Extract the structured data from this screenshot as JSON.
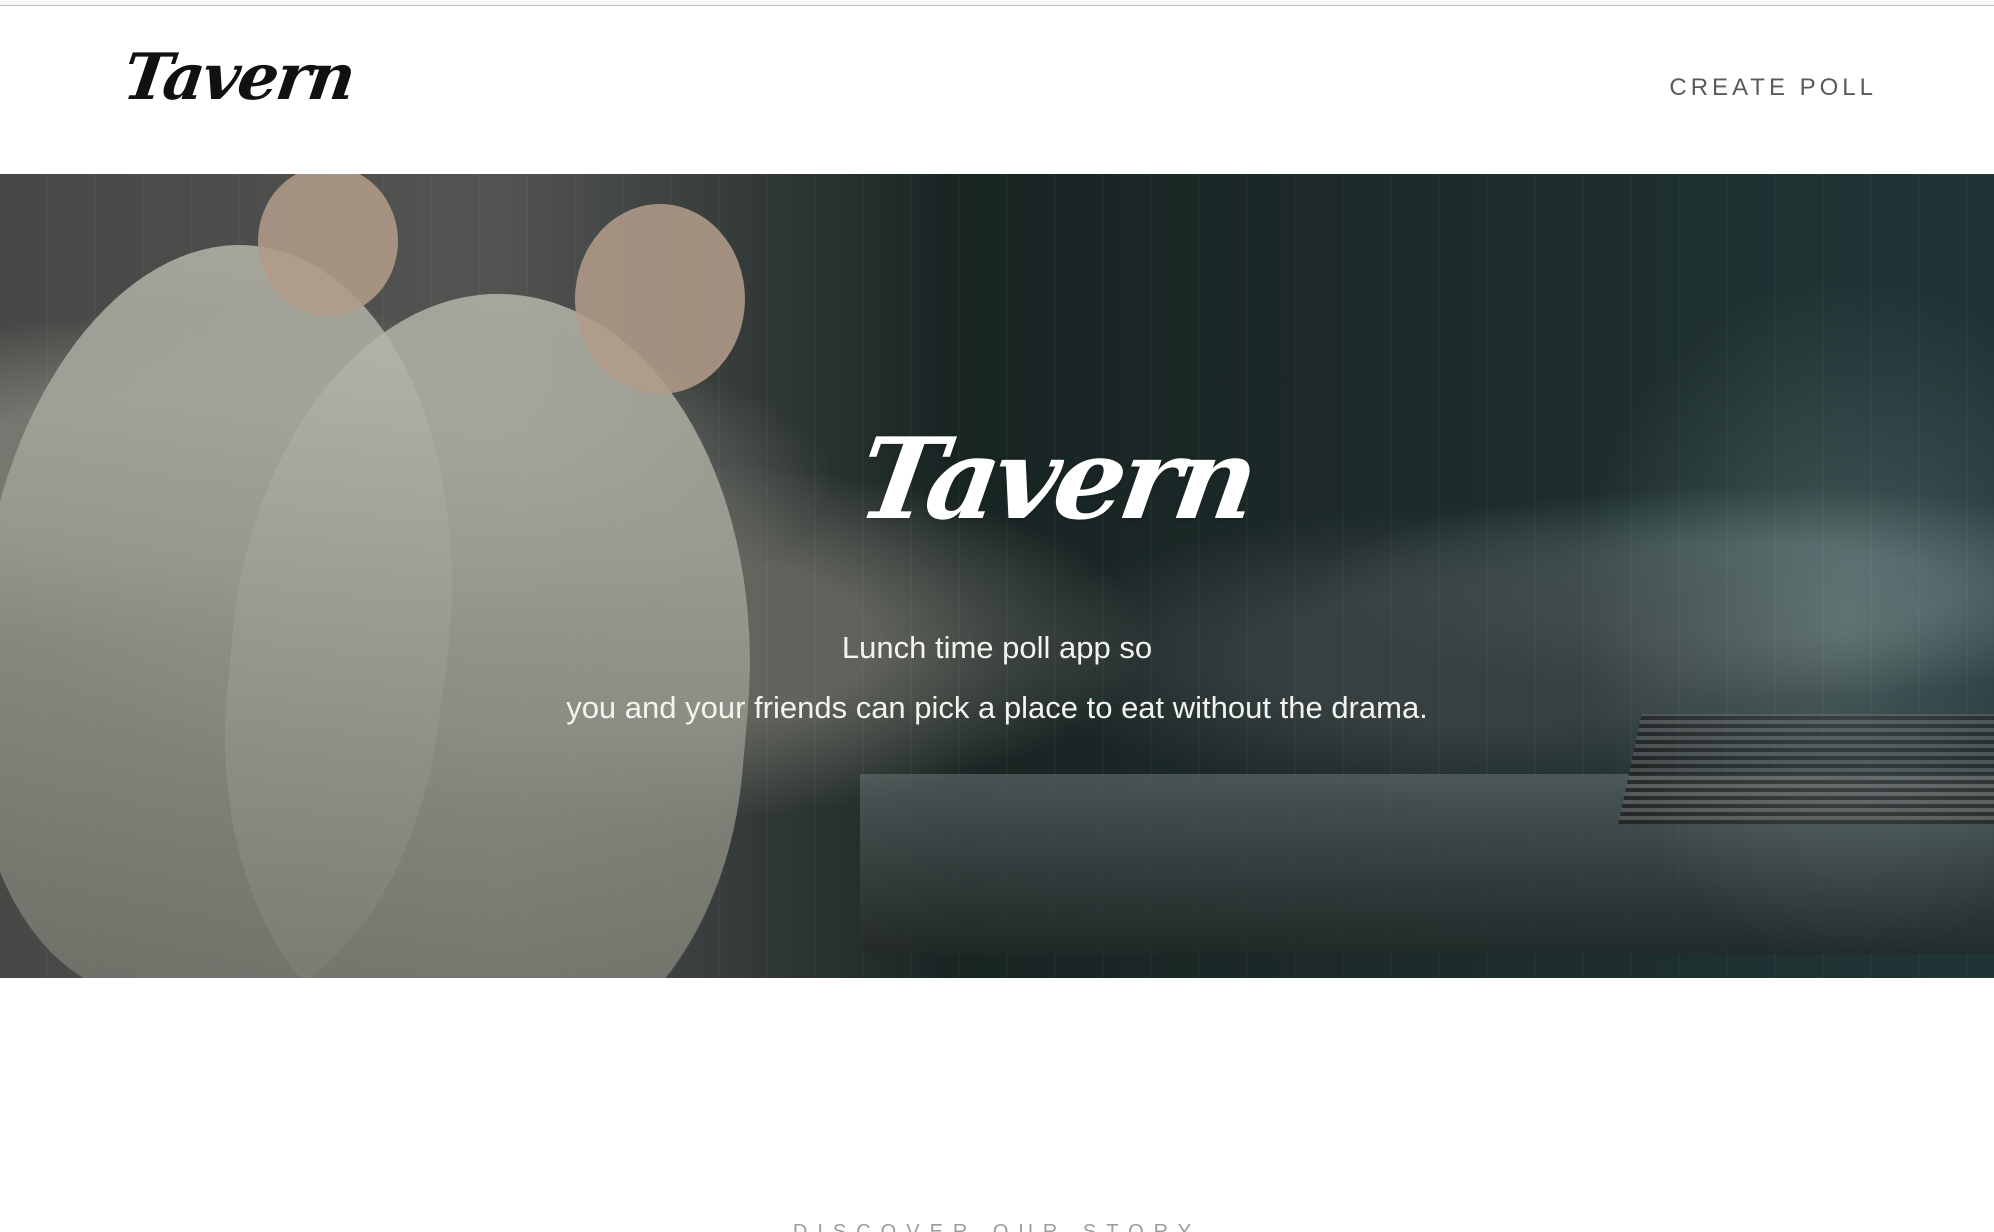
{
  "brand": {
    "name": "Tavern"
  },
  "nav": {
    "create_poll": "CREATE POLL"
  },
  "hero": {
    "title": "Tavern",
    "tagline_line_1": "Lunch time poll app so",
    "tagline_line_2": "you and your friends can pick a place to eat without the drama."
  },
  "section": {
    "discover_label": "DISCOVER OUR STORY"
  },
  "colors": {
    "background": "#ffffff",
    "logo": "#111111",
    "nav_text": "#5b5b5b",
    "hero_text": "#ffffff",
    "hero_overlay": "#20312f",
    "section_label": "#9c9c9c"
  }
}
